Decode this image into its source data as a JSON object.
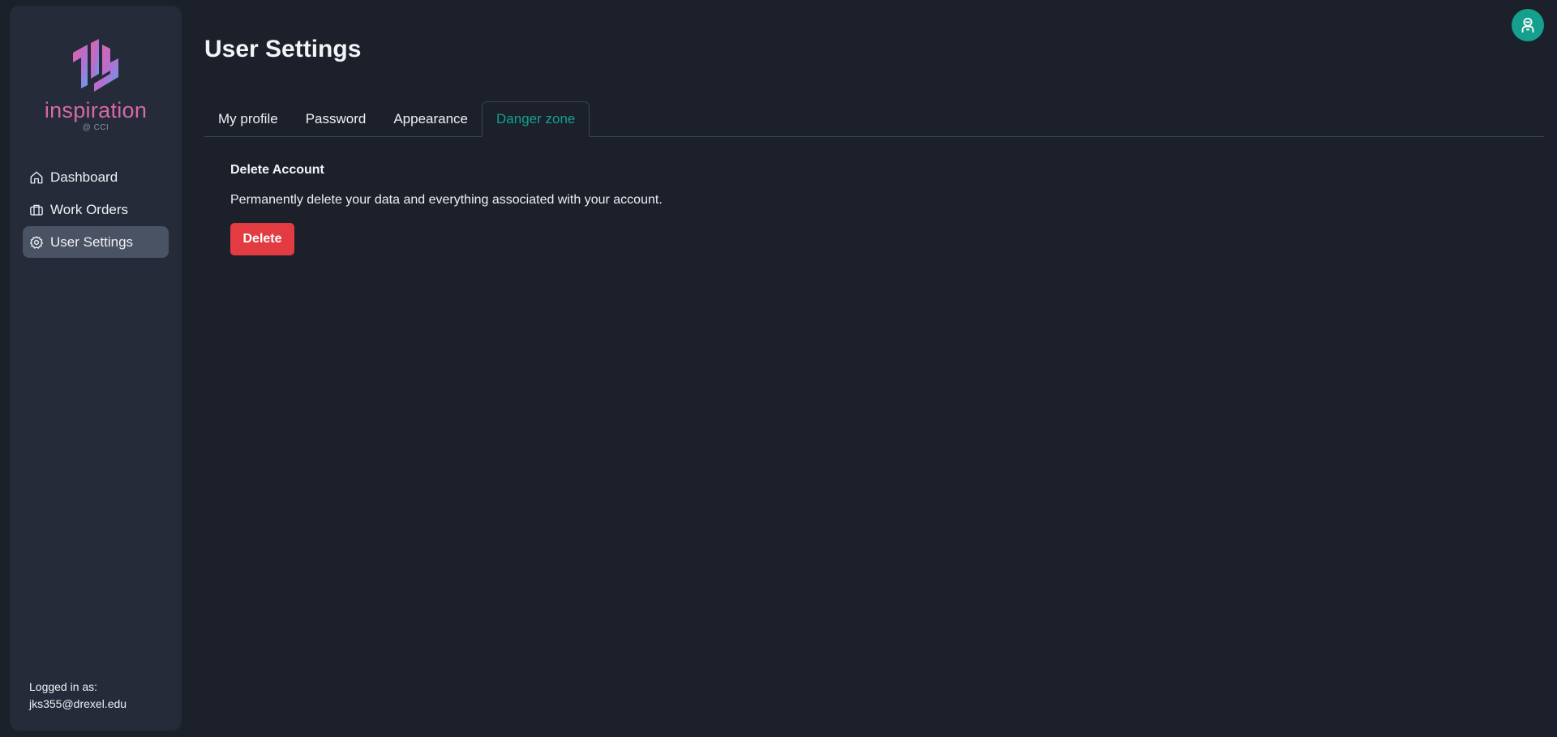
{
  "app": {
    "brand_name": "inspiration",
    "brand_sub": "@ CCI",
    "accent_color": "#14a08d",
    "brand_color": "#d66aa6"
  },
  "sidebar": {
    "items": [
      {
        "label": "Dashboard",
        "icon": "home-icon",
        "active": false
      },
      {
        "label": "Work Orders",
        "icon": "briefcase-icon",
        "active": false
      },
      {
        "label": "User Settings",
        "icon": "gear-icon",
        "active": true
      }
    ],
    "logged_in_label": "Logged in as:",
    "logged_in_user": "jks355@drexel.edu"
  },
  "header": {
    "avatar_icon": "user-avatar-icon"
  },
  "main": {
    "title": "User Settings",
    "tabs": [
      {
        "label": "My profile",
        "active": false
      },
      {
        "label": "Password",
        "active": false
      },
      {
        "label": "Appearance",
        "active": false
      },
      {
        "label": "Danger zone",
        "active": true
      }
    ],
    "danger": {
      "heading": "Delete Account",
      "description": "Permanently delete your data and everything associated with your account.",
      "delete_label": "Delete",
      "delete_color": "#e23b42"
    }
  }
}
